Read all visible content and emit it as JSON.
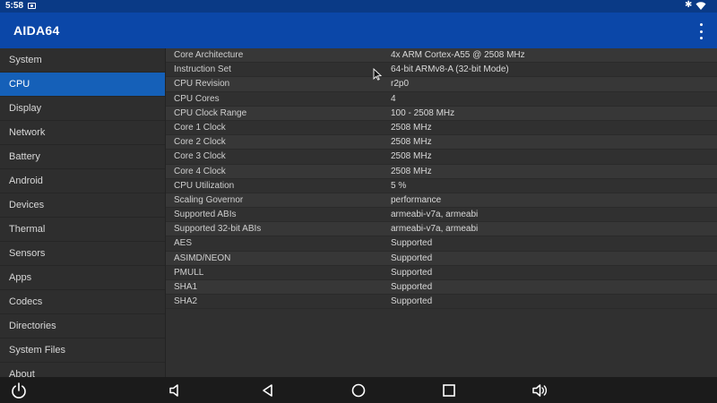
{
  "status_bar": {
    "time": "5:58",
    "icons": [
      "screenshot-icon",
      "bluetooth-icon",
      "wifi-icon"
    ]
  },
  "app_bar": {
    "title": "AIDA64",
    "menu_icon": "overflow-menu-icon"
  },
  "sidebar": {
    "items": [
      {
        "label": "System"
      },
      {
        "label": "CPU",
        "active": true
      },
      {
        "label": "Display"
      },
      {
        "label": "Network"
      },
      {
        "label": "Battery"
      },
      {
        "label": "Android"
      },
      {
        "label": "Devices"
      },
      {
        "label": "Thermal"
      },
      {
        "label": "Sensors"
      },
      {
        "label": "Apps"
      },
      {
        "label": "Codecs"
      },
      {
        "label": "Directories"
      },
      {
        "label": "System Files"
      },
      {
        "label": "About"
      }
    ]
  },
  "cpu_info": {
    "rows": [
      {
        "key": "Core Architecture",
        "value": "4x ARM Cortex-A55 @ 2508 MHz"
      },
      {
        "key": "Instruction Set",
        "value": "64-bit ARMv8-A (32-bit Mode)"
      },
      {
        "key": "CPU Revision",
        "value": "r2p0"
      },
      {
        "key": "CPU Cores",
        "value": "4"
      },
      {
        "key": "CPU Clock Range",
        "value": "100 - 2508 MHz"
      },
      {
        "key": "Core 1 Clock",
        "value": "2508 MHz"
      },
      {
        "key": "Core 2 Clock",
        "value": "2508 MHz"
      },
      {
        "key": "Core 3 Clock",
        "value": "2508 MHz"
      },
      {
        "key": "Core 4 Clock",
        "value": "2508 MHz"
      },
      {
        "key": "CPU Utilization",
        "value": "5 %"
      },
      {
        "key": "Scaling Governor",
        "value": "performance"
      },
      {
        "key": "Supported ABIs",
        "value": "armeabi-v7a, armeabi"
      },
      {
        "key": "Supported 32-bit ABIs",
        "value": "armeabi-v7a, armeabi"
      },
      {
        "key": "AES",
        "value": "Supported"
      },
      {
        "key": "ASIMD/NEON",
        "value": "Supported"
      },
      {
        "key": "PMULL",
        "value": "Supported"
      },
      {
        "key": "SHA1",
        "value": "Supported"
      },
      {
        "key": "SHA2",
        "value": "Supported"
      }
    ]
  },
  "nav_bar": {
    "buttons": [
      "power-icon",
      "volume-down-icon",
      "back-icon",
      "home-icon",
      "recents-icon",
      "volume-up-icon"
    ]
  },
  "colors": {
    "app_bar": "#0b47a8",
    "status_bar": "#0a3a86",
    "active_item": "#1560b8",
    "background": "#303030"
  }
}
